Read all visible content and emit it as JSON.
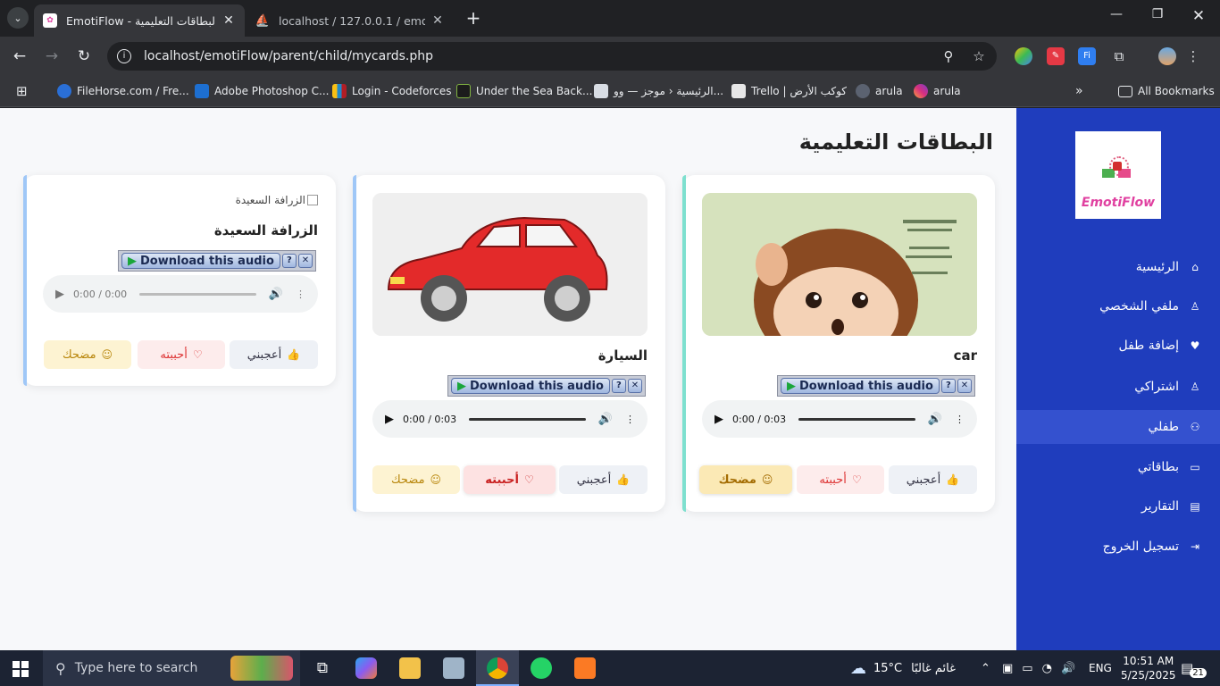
{
  "browser": {
    "tabs": [
      {
        "title": "EmotiFlow - البطاقات التعليمية",
        "close": "✕"
      },
      {
        "title": "localhost / 127.0.0.1 / emotiflow",
        "close": "✕"
      }
    ],
    "new_tab": "+",
    "url": "localhost/emotiFlow/parent/child/mycards.php",
    "bookmarks": [
      "FileHorse.com / Fre...",
      "Adobe Photoshop C...",
      "Login - Codeforces",
      "Under the Sea Back...",
      "الرئيسية ‹ موجز — وو...",
      "Trello | كوكب الأرض",
      "arula",
      "arula"
    ],
    "all_bookmarks": "All Bookmarks"
  },
  "app": {
    "logo_text": "EmotiFlow",
    "page_title": "البطاقات التعليمية",
    "nav": [
      {
        "label": "الرئيسية",
        "icon": "home-icon",
        "glyph": "⌂"
      },
      {
        "label": "ملفي الشخصي",
        "icon": "user-icon",
        "glyph": "♙"
      },
      {
        "label": "إضافة طفل",
        "icon": "heart-icon",
        "glyph": "♥"
      },
      {
        "label": "اشتراكي",
        "icon": "user-icon",
        "glyph": "♙"
      },
      {
        "label": "طفلي",
        "icon": "users-icon",
        "glyph": "⚇"
      },
      {
        "label": "بطاقاتي",
        "icon": "card-icon",
        "glyph": "▭"
      },
      {
        "label": "التقارير",
        "icon": "report-icon",
        "glyph": "▤"
      },
      {
        "label": "تسجيل الخروج",
        "icon": "logout-icon",
        "glyph": "⇥"
      }
    ],
    "cards": [
      {
        "name": "car",
        "image": "monkey-illustration",
        "audio_time": "0:00 / 0:03",
        "download": "Download this audio",
        "reactions": {
          "like": "أعجبني",
          "love": "أحببته",
          "funny": "مضحك"
        },
        "selected": "funny",
        "accent": "#7ee0cf"
      },
      {
        "name": "السيارة",
        "image": "red-car",
        "audio_time": "0:00 / 0:03",
        "download": "Download this audio",
        "reactions": {
          "like": "أعجبني",
          "love": "أحببته",
          "funny": "مضحك"
        },
        "selected": "love",
        "accent": "#9fc7f7"
      },
      {
        "name": "الزرافة السعيدة",
        "image_alt": "الزرافة السعيدة",
        "audio_time": "0:00 / 0:00",
        "download": "Download this audio",
        "reactions": {
          "like": "أعجبني",
          "love": "أحببته",
          "funny": "مضحك"
        },
        "selected": "",
        "accent": "#9fc7f7"
      }
    ]
  },
  "taskbar": {
    "search_placeholder": "Type here to search",
    "weather": "15°C",
    "weather_text": "غائم غالبًا",
    "language": "ENG",
    "time": "10:51 AM",
    "date": "5/25/2025",
    "notifications": "21"
  }
}
